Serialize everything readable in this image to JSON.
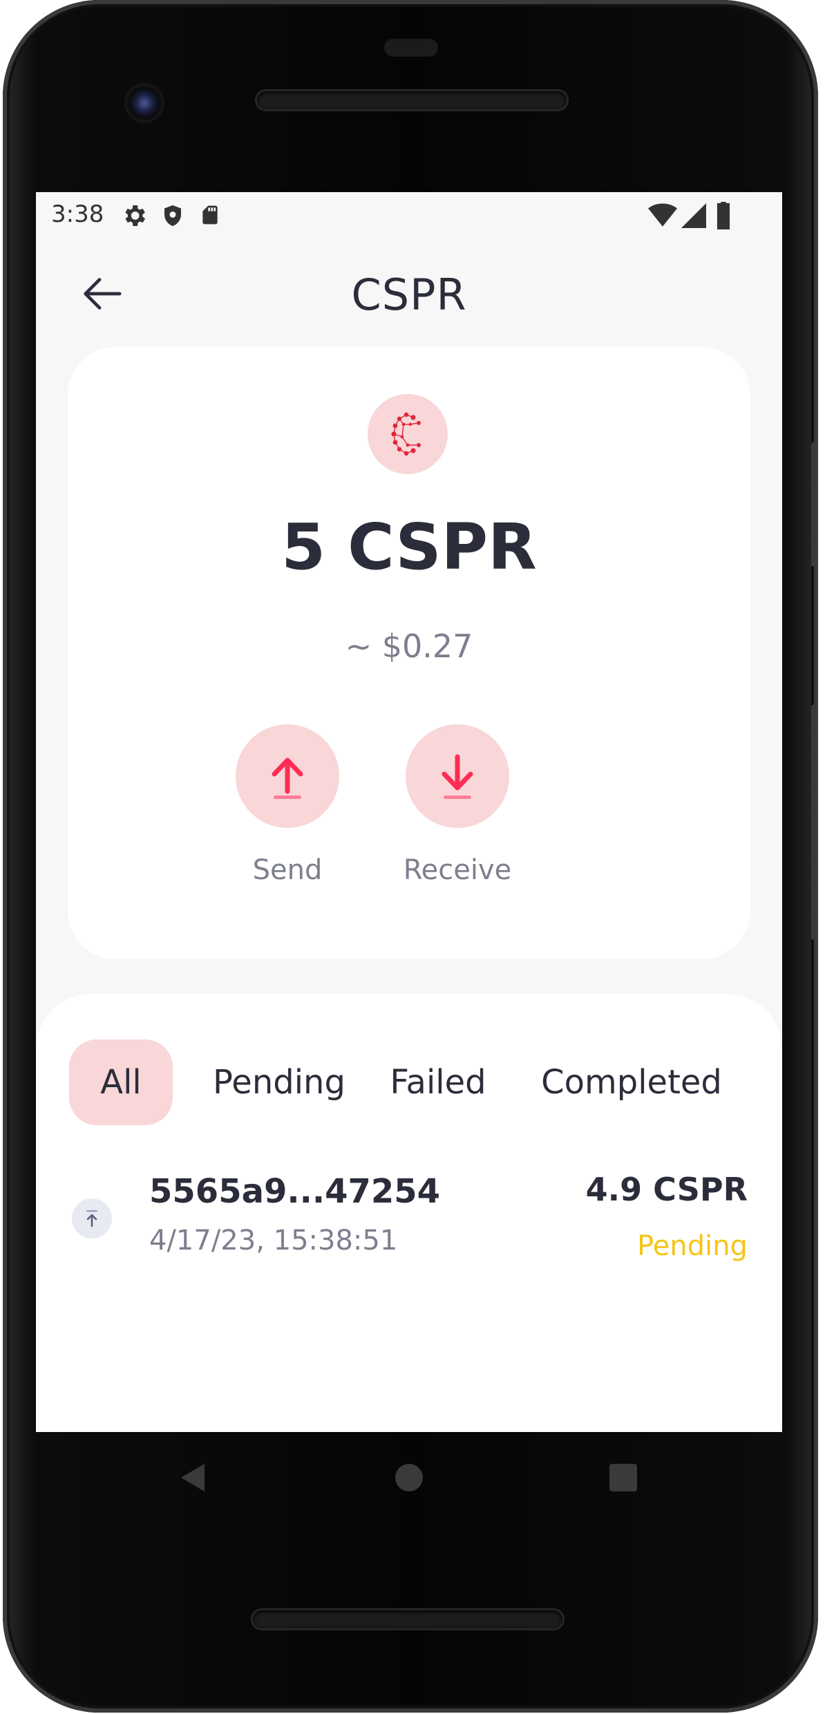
{
  "status_bar": {
    "time": "3:38",
    "left_icons": [
      "settings-icon",
      "shield-icon",
      "sd-card-icon"
    ],
    "right_icons": [
      "wifi-icon",
      "signal-icon",
      "battery-icon"
    ]
  },
  "header": {
    "title": "CSPR",
    "back_icon": "arrow-left-icon"
  },
  "balance_card": {
    "token_icon": "casper-logo-icon",
    "balance": "5 CSPR",
    "fiat_value": "~ $0.27",
    "actions": [
      {
        "label": "Send",
        "icon": "arrow-up-icon"
      },
      {
        "label": "Receive",
        "icon": "arrow-down-icon"
      }
    ]
  },
  "transactions": {
    "tabs": [
      {
        "label": "All",
        "active": true
      },
      {
        "label": "Pending",
        "active": false
      },
      {
        "label": "Failed",
        "active": false
      },
      {
        "label": "Completed",
        "active": false
      }
    ],
    "items": [
      {
        "icon": "outgoing-arrow-icon",
        "hash": "5565a9...47254",
        "datetime": "4/17/23, 15:38:51",
        "amount": "4.9 CSPR",
        "status": "Pending"
      }
    ]
  },
  "nav_bar": {
    "buttons": [
      "back-triangle-icon",
      "home-circle-icon",
      "recents-square-icon"
    ]
  },
  "colors": {
    "accent": "#ff2d55",
    "accent_soft": "#f9d6d8",
    "text_primary": "#2b2d3a",
    "text_secondary": "#7d7f8e",
    "pending": "#f5c518",
    "screen_bg": "#f7f7f8"
  }
}
